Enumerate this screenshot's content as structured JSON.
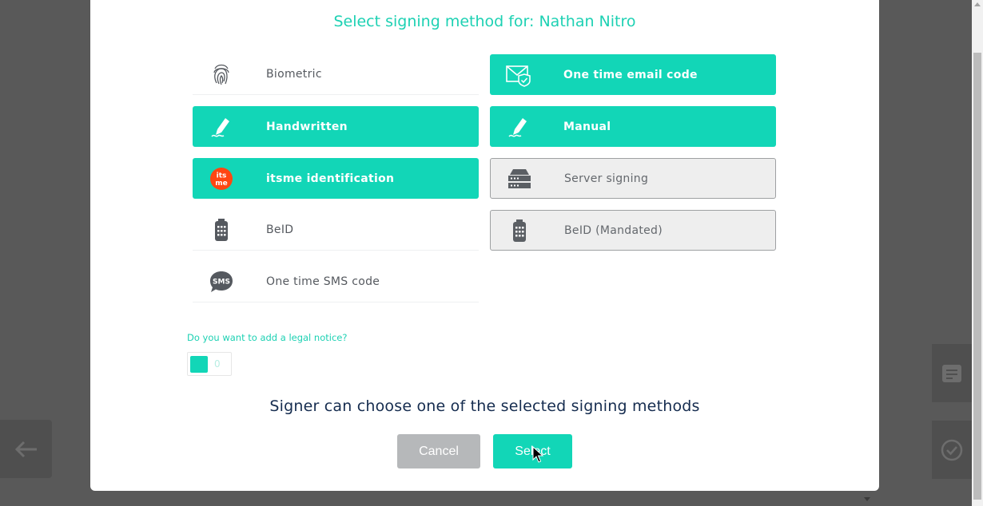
{
  "dialog": {
    "title": "Select signing method for: Nathan Nitro",
    "methods_left": [
      {
        "label": "Biometric",
        "icon": "fingerprint-icon",
        "state": "unselected"
      },
      {
        "label": "Handwritten",
        "icon": "pen-signature-icon",
        "state": "selected"
      },
      {
        "label": "itsme identification",
        "icon": "itsme-logo-icon",
        "state": "selected"
      },
      {
        "label": "BeID",
        "icon": "card-reader-icon",
        "state": "unselected"
      },
      {
        "label": "One time SMS code",
        "icon": "sms-bubble-icon",
        "state": "unselected"
      }
    ],
    "methods_right": [
      {
        "label": "One time email code",
        "icon": "email-check-icon",
        "state": "selected"
      },
      {
        "label": "Manual",
        "icon": "pen-signature-icon",
        "state": "selected"
      },
      {
        "label": "Server signing",
        "icon": "server-icon",
        "state": "disabled"
      },
      {
        "label": "BeID (Mandated)",
        "icon": "card-reader-icon",
        "state": "disabled"
      }
    ],
    "legal_notice": {
      "question": "Do you want to add a legal notice?",
      "count": "0"
    },
    "note": "Signer can choose one of the selected signing methods",
    "buttons": {
      "cancel": "Cancel",
      "select": "Select"
    }
  },
  "colors": {
    "accent": "#12d6b7",
    "title": "#1dd1b3",
    "disabled_bg": "#eeeeee",
    "overlay": "#595959"
  }
}
